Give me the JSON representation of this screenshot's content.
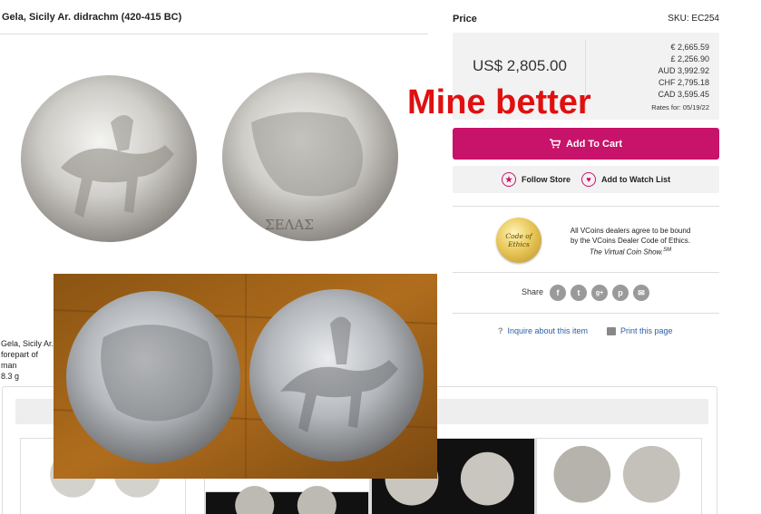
{
  "product": {
    "title": "Gela, Sicily Ar. didrachm (420-415 BC)",
    "description_lines": [
      "Gela, Sicily Ar.",
      "forepart of man",
      "8.3 g"
    ],
    "coin_photo_name": "gela-didrachm-obverse-reverse"
  },
  "pricing": {
    "label": "Price",
    "sku": "SKU: EC254",
    "main_price": "US$ 2,805.00",
    "rates": [
      "€ 2,665.59",
      "£ 2,256.90",
      "AUD 3,992.92",
      "CHF 2,795.18",
      "CAD 3,595.45"
    ],
    "rates_date": "Rates for: 05/19/22"
  },
  "actions": {
    "add_to_cart": "Add To Cart",
    "follow_store": "Follow Store",
    "add_to_watch_list": "Add to Watch List"
  },
  "ethics": {
    "seal_line1": "Code of",
    "seal_line2": "Ethics",
    "text_line1": "All VCoins dealers agree to be bound",
    "text_line2": "by the VCoins Dealer Code of Ethics.",
    "text_line3": "The Virtual Coin Show.",
    "text_sup": "SM"
  },
  "share": {
    "label": "Share",
    "icons": [
      "facebook-icon",
      "twitter-icon",
      "google-plus-icon",
      "pinterest-icon",
      "email-icon"
    ],
    "icon_glyphs": [
      "f",
      "t",
      "g+",
      "p",
      "✉"
    ]
  },
  "links": {
    "inquire": "Inquire about this item",
    "print": "Print this page"
  },
  "overlay": {
    "text": "Mine better",
    "color": "#e01010"
  },
  "colors": {
    "accent": "#c8136a",
    "link": "#2a5fa8"
  }
}
